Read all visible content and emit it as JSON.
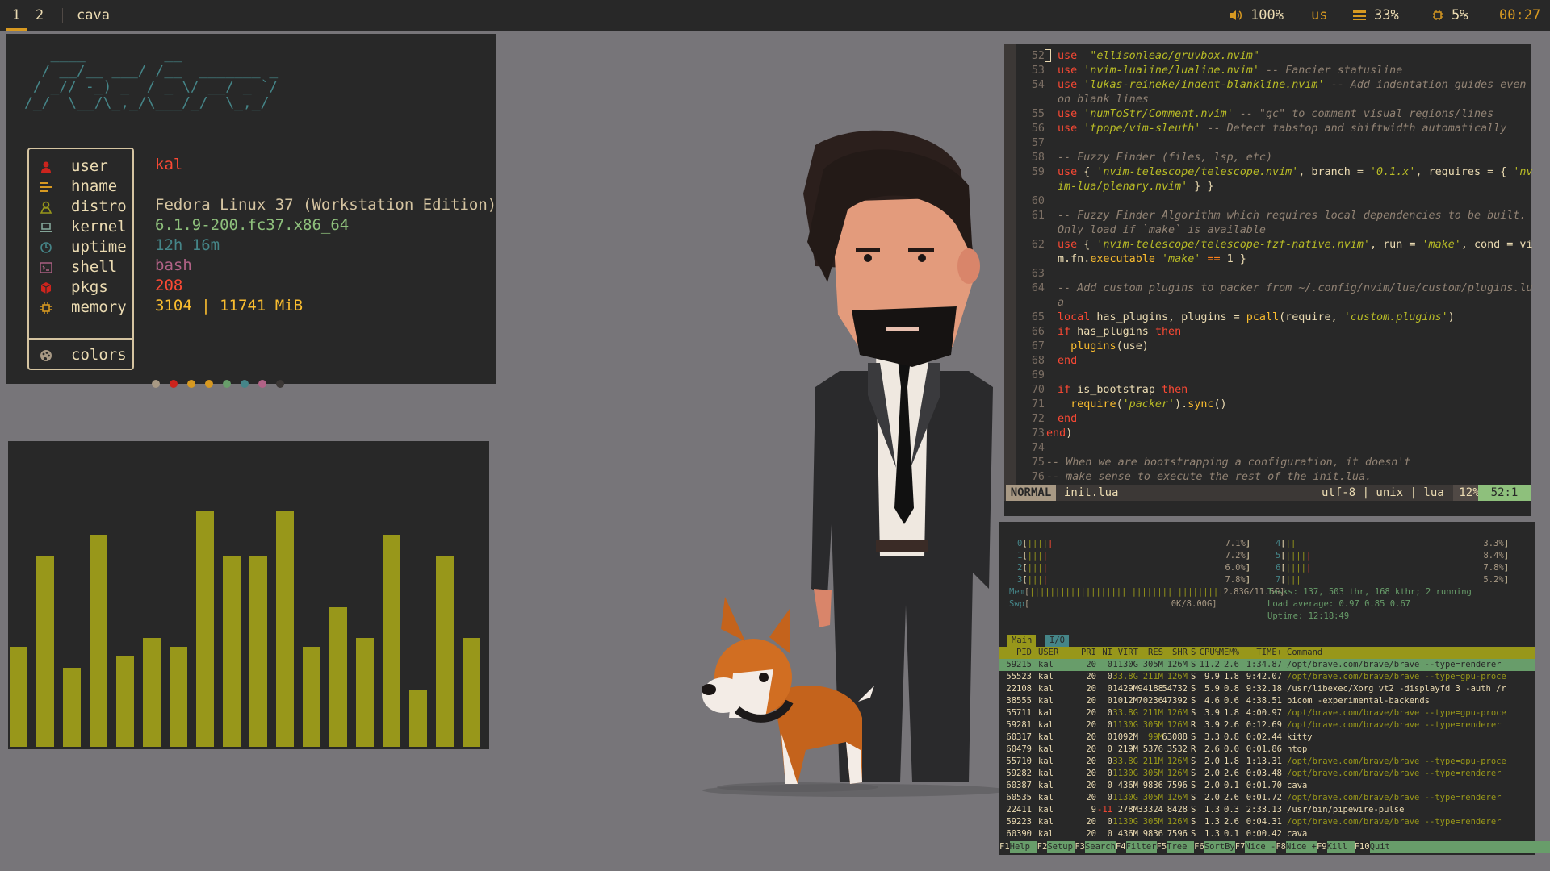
{
  "topbar": {
    "workspaces": [
      "1",
      "2"
    ],
    "active_workspace": "1",
    "window_title": "cava",
    "volume": "100%",
    "keyboard_layout": "us",
    "memory": "33%",
    "cpu": "5%",
    "clock": "00:27"
  },
  "neofetch": {
    "logo": "   ____         __\n  / __/__ ___/ /__  _______ _\n / _// -_) _  / _ \\/ __/ _ `/\n/_/  \\__/\\_,_/\\___/_/  \\_,_/",
    "rows": [
      {
        "label": "user",
        "value": "kal",
        "icon": "user-icon"
      },
      {
        "label": "hname",
        "value": "",
        "icon": "hostname-icon"
      },
      {
        "label": "distro",
        "value": "Fedora Linux 37 (Workstation Edition)",
        "icon": "distro-icon"
      },
      {
        "label": "kernel",
        "value": "6.1.9-200.fc37.x86_64",
        "icon": "laptop-icon"
      },
      {
        "label": "uptime",
        "value": "12h 16m",
        "icon": "clock-icon"
      },
      {
        "label": "shell",
        "value": "bash",
        "icon": "terminal-icon"
      },
      {
        "label": "pkgs",
        "value": "208",
        "icon": "package-icon"
      },
      {
        "label": "memory",
        "value": "3104 | 11741 MiB",
        "icon": "memory-icon"
      }
    ],
    "colors_label": "colors",
    "palette": [
      "#a89984",
      "#cc241d",
      "#d79921",
      "#d79921",
      "#689d6a",
      "#458588",
      "#b16286",
      "#3c3836"
    ]
  },
  "cava": {
    "color": "#98971a",
    "levels": [
      0.33,
      0.63,
      0.26,
      0.7,
      0.3,
      0.36,
      0.33,
      0.78,
      0.63,
      0.63,
      0.78,
      0.33,
      0.46,
      0.36,
      0.7,
      0.19,
      0.63,
      0.36
    ]
  },
  "nvim": {
    "mode": "NORMAL",
    "file": "init.lua",
    "encoding": "utf-8 | unix | lua",
    "percent": "12%",
    "position": "52:1",
    "lines": [
      {
        "n": "52",
        "html": "<span class='kw'>use</span>  <span class='str'>\"ellisonleao/gruvbox.nvim\"</span>"
      },
      {
        "n": "53",
        "html": "<span class='kw'>use</span> <span class='str'>'nvim-lualine/lualine.nvim'</span> <span class='cm'>-- Fancier statusline</span>"
      },
      {
        "n": "54",
        "html": "<span class='kw'>use</span> <span class='str'>'lukas-reineke/indent-blankline.nvim'</span> <span class='cm'>-- Add indentation guides even</span>"
      },
      {
        "n": "",
        "html": "<span class='cm'>on blank lines</span>"
      },
      {
        "n": "55",
        "html": "<span class='kw'>use</span> <span class='str'>'numToStr/Comment.nvim'</span> <span class='cm'>-- \"gc\" to comment visual regions/lines</span>"
      },
      {
        "n": "56",
        "html": "<span class='kw'>use</span> <span class='str'>'tpope/vim-sleuth'</span> <span class='cm'>-- Detect tabstop and shiftwidth automatically</span>"
      },
      {
        "n": "57",
        "html": ""
      },
      {
        "n": "58",
        "html": "<span class='cm'>-- Fuzzy Finder (files, lsp, etc)</span>"
      },
      {
        "n": "59",
        "html": "<span class='kw'>use</span> { <span class='str'>'nvim-telescope/telescope.nvim'</span>, branch = <span class='str'>'0.1.x'</span>, requires = { <span class='str'>'nv</span>"
      },
      {
        "n": "",
        "html": "<span class='str'>im-lua/plenary.nvim'</span> } }"
      },
      {
        "n": "60",
        "html": ""
      },
      {
        "n": "61",
        "html": "<span class='cm'>-- Fuzzy Finder Algorithm which requires local dependencies to be built.</span>"
      },
      {
        "n": "",
        "html": "<span class='cm'>Only load if `make` is available</span>"
      },
      {
        "n": "62",
        "html": "<span class='kw'>use</span> { <span class='str'>'nvim-telescope/telescope-fzf-native.nvim'</span>, run = <span class='str'>'make'</span>, cond = vi</span>"
      },
      {
        "n": "",
        "html": "m.fn.<span class='fn'>executable</span> <span class='str'>'make'</span> <span class='op'>==</span> 1 }"
      },
      {
        "n": "63",
        "html": ""
      },
      {
        "n": "64",
        "html": "<span class='cm'>-- Add custom plugins to packer from ~/.config/nvim/lua/custom/plugins.lu</span>"
      },
      {
        "n": "",
        "html": "<span class='cm'>a</span>"
      },
      {
        "n": "65",
        "html": "<span class='kw'>local</span> has_plugins, plugins = <span class='fn'>pcall</span>(require, <span class='str'>'custom.plugins'</span>)"
      },
      {
        "n": "66",
        "html": "<span class='kw'>if</span> has_plugins <span class='kw'>then</span>"
      },
      {
        "n": "67",
        "html": "  <span class='fn'>plugins</span>(use)"
      },
      {
        "n": "68",
        "html": "<span class='kw'>end</span>"
      },
      {
        "n": "69",
        "html": ""
      },
      {
        "n": "70",
        "html": "<span class='kw'>if</span> is_bootstrap <span class='kw'>then</span>"
      },
      {
        "n": "71",
        "html": "  <span class='fn'>require</span>(<span class='str'>'packer'</span>).<span class='fn'>sync</span>()"
      },
      {
        "n": "72",
        "html": "<span class='kw'>end</span>"
      },
      {
        "n": "73",
        "html": "<span class='kw'>end</span>)",
        "indent": -1
      },
      {
        "n": "74",
        "html": ""
      },
      {
        "n": "75",
        "html": "<span class='cm'>-- When we are bootstrapping a configuration, it doesn't</span>",
        "indent": -1
      },
      {
        "n": "76",
        "html": "<span class='cm'>-- make sense to execute the rest of the init.lua.</span>",
        "indent": -1
      }
    ]
  },
  "htop": {
    "cpus": [
      {
        "id": "0",
        "bars": "||||",
        "red": "|",
        "pct": "7.1%"
      },
      {
        "id": "1",
        "bars": "|||",
        "red": "|",
        "pct": "7.2%"
      },
      {
        "id": "2",
        "bars": "|||",
        "red": "|",
        "pct": "6.0%"
      },
      {
        "id": "3",
        "bars": "|||",
        "red": "|",
        "pct": "7.8%"
      },
      {
        "id": "4",
        "bars": "||",
        "red": "",
        "pct": "3.3%"
      },
      {
        "id": "5",
        "bars": "||||",
        "red": "|",
        "pct": "8.4%"
      },
      {
        "id": "6",
        "bars": "||||",
        "red": "|",
        "pct": "7.8%"
      },
      {
        "id": "7",
        "bars": "|||",
        "red": "",
        "pct": "5.2%"
      }
    ],
    "mem_label": "Mem",
    "mem_bar": "||||||||||||||||||||||||||||||||||||||",
    "mem_value": "2.83G/11.5G",
    "swp_label": "Swp",
    "swp_value": "0K/8.00G",
    "tasks": "Tasks: 137, 503 thr, 168 kthr; 2 running",
    "load": "Load average: 0.97 0.85 0.67",
    "uptime": "Uptime: 12:18:49",
    "tab_main": "Main",
    "tab_io": "I/O",
    "headers": [
      "PID",
      "USER",
      "PRI",
      "NI",
      "VIRT",
      "RES",
      "SHR",
      "S",
      "CPU%",
      "MEM%",
      "TIME+",
      "Command"
    ],
    "processes": [
      [
        "59215",
        "kal",
        "20",
        "0",
        "1130G",
        "305M",
        "126M",
        "S",
        "11.2",
        "2.6",
        "1:34.87",
        "/opt/brave.com/brave/brave --type=renderer"
      ],
      [
        "55523",
        "kal",
        "20",
        "0",
        "33.8G",
        "211M",
        "126M",
        "S",
        "9.9",
        "1.8",
        "9:42.07",
        "/opt/brave.com/brave/brave --type=gpu-proce"
      ],
      [
        "22108",
        "kal",
        "20",
        "0",
        "1429M",
        "94188",
        "54732",
        "S",
        "5.9",
        "0.8",
        "9:32.18",
        "/usr/libexec/Xorg vt2 -displayfd 3 -auth /r"
      ],
      [
        "38555",
        "kal",
        "20",
        "0",
        "1012M",
        "70236",
        "47392",
        "S",
        "4.6",
        "0.6",
        "4:38.51",
        "picom -experimental-backends"
      ],
      [
        "55711",
        "kal",
        "20",
        "0",
        "33.8G",
        "211M",
        "126M",
        "S",
        "3.9",
        "1.8",
        "4:00.97",
        "/opt/brave.com/brave/brave --type=gpu-proce"
      ],
      [
        "59281",
        "kal",
        "20",
        "0",
        "1130G",
        "305M",
        "126M",
        "R",
        "3.9",
        "2.6",
        "0:12.69",
        "/opt/brave.com/brave/brave --type=renderer"
      ],
      [
        "60317",
        "kal",
        "20",
        "0",
        "1092M",
        "99M",
        "63088",
        "S",
        "3.3",
        "0.8",
        "0:02.44",
        "kitty"
      ],
      [
        "60479",
        "kal",
        "20",
        "0",
        "219M",
        "5376",
        "3532",
        "R",
        "2.6",
        "0.0",
        "0:01.86",
        "htop"
      ],
      [
        "55710",
        "kal",
        "20",
        "0",
        "33.8G",
        "211M",
        "126M",
        "S",
        "2.0",
        "1.8",
        "1:13.31",
        "/opt/brave.com/brave/brave --type=gpu-proce"
      ],
      [
        "59282",
        "kal",
        "20",
        "0",
        "1130G",
        "305M",
        "126M",
        "S",
        "2.0",
        "2.6",
        "0:03.48",
        "/opt/brave.com/brave/brave --type=renderer"
      ],
      [
        "60387",
        "kal",
        "20",
        "0",
        "436M",
        "9836",
        "7596",
        "S",
        "2.0",
        "0.1",
        "0:01.70",
        "cava"
      ],
      [
        "60535",
        "kal",
        "20",
        "0",
        "1130G",
        "305M",
        "126M",
        "S",
        "2.0",
        "2.6",
        "0:01.72",
        "/opt/brave.com/brave/brave --type=renderer"
      ],
      [
        "22411",
        "kal",
        "9",
        "-11",
        "278M",
        "33324",
        "8428",
        "S",
        "1.3",
        "0.3",
        "2:33.13",
        "/usr/bin/pipewire-pulse"
      ],
      [
        "59223",
        "kal",
        "20",
        "0",
        "1130G",
        "305M",
        "126M",
        "S",
        "1.3",
        "2.6",
        "0:04.31",
        "/opt/brave.com/brave/brave --type=renderer"
      ],
      [
        "60390",
        "kal",
        "20",
        "0",
        "436M",
        "9836",
        "7596",
        "S",
        "1.3",
        "0.1",
        "0:00.42",
        "cava"
      ]
    ],
    "fkeys": [
      {
        "k": "F1",
        "d": "Help"
      },
      {
        "k": "F2",
        "d": "Setup"
      },
      {
        "k": "F3",
        "d": "Search"
      },
      {
        "k": "F4",
        "d": "Filter"
      },
      {
        "k": "F5",
        "d": "Tree"
      },
      {
        "k": "F6",
        "d": "SortBy"
      },
      {
        "k": "F7",
        "d": "Nice -"
      },
      {
        "k": "F8",
        "d": "Nice +"
      },
      {
        "k": "F9",
        "d": "Kill"
      },
      {
        "k": "F10",
        "d": "Quit"
      }
    ]
  }
}
